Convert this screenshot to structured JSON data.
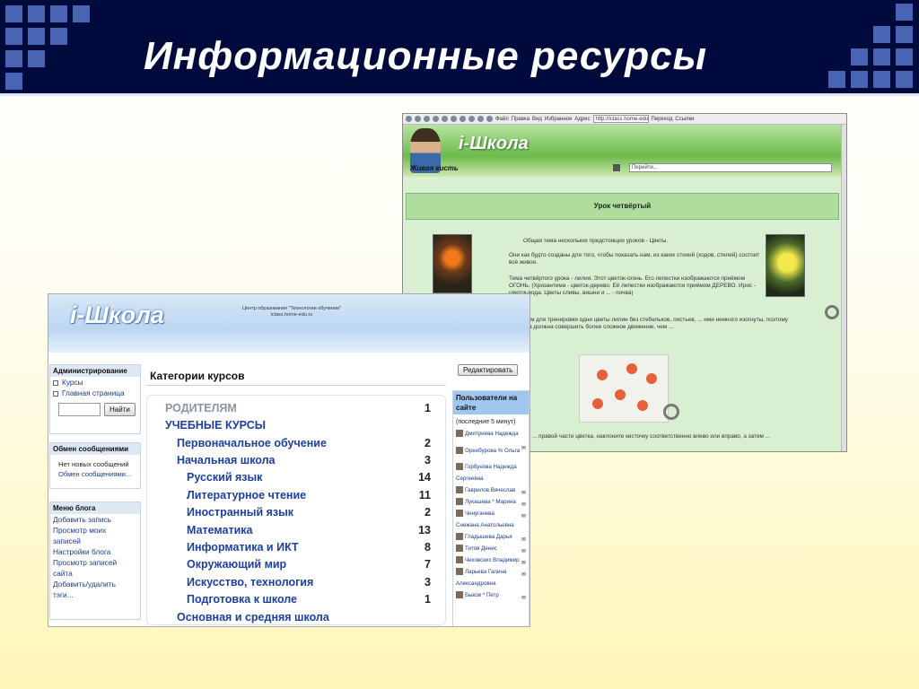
{
  "slide": {
    "title": "Информационные ресурсы",
    "accent_color": "#000a3c",
    "square_color": "#4a64b4"
  },
  "back_window": {
    "toolbar": {
      "items": [
        "Файл",
        "Правка",
        "Вид",
        "Избранное",
        "Адрес"
      ],
      "address": "http://iclass.home-edu...",
      "go_label": "Переход",
      "links_label": "Ссылки"
    },
    "logo": "i-Школа",
    "section_title": "Живая кисть",
    "goto_placeholder": "Перейти...",
    "lesson_title": "Урок четвёртый",
    "paragraphs": [
      "Общая тема нескольких предстоящих уроков - Цветы.",
      "Они как будто созданы для того, чтобы показать нам, из каких стихий (ходов, стилей) состоит всё живое.",
      "Тема четвёртого урока - лилия. Этот цветок-огонь. Его лепестки изображаются приёмом ОГОНЬ. (Хризантема - цветок-дерево. Её лепестки изображаются приёмом ДЕРЕВО. Ирис - цветок-вода. Цветы сливы, вишни и ... - почва)",
      "... рисуем для тренировки одни цветы лилии без стебельков, листьев, ... ими немного изогнуты, поэтому кисточка должна совершить более сложное движение, чем ...",
      "... правой части цветка, наклоните кисточку соответственно влево или вправо, а затем ..."
    ]
  },
  "front_window": {
    "logo": "i-Школа",
    "center_name": "Центр образования \"Технологии обучения\"",
    "center_url": "iclass.home-edu.ru",
    "admin": {
      "title": "Администрирование",
      "items": [
        "Курсы",
        "Главная страница"
      ],
      "search_button": "Найти"
    },
    "messages": {
      "title": "Обмен сообщениями",
      "none": "Нет новых сообщений",
      "link": "Обмен сообщениями..."
    },
    "blog": {
      "title": "Меню блога",
      "items": [
        "Добавить запись",
        "Просмотр моих",
        "записей",
        "Настройки блога",
        "Просмотр записей",
        "сайта",
        "Добавить/удалить",
        "тэги..."
      ]
    },
    "categories_title": "Категории курсов",
    "categories": [
      {
        "label": "РОДИТЕЛЯМ",
        "count": "1"
      },
      {
        "label": "УЧЕБНЫЕ КУРСЫ",
        "count": ""
      },
      {
        "label": "Первоначальное обучение",
        "count": "2"
      },
      {
        "label": "Начальная школа",
        "count": "3"
      },
      {
        "label": "Русский язык",
        "count": "14"
      },
      {
        "label": "Литературное чтение",
        "count": "11"
      },
      {
        "label": "Иностранный язык",
        "count": "2"
      },
      {
        "label": "Математика",
        "count": "13"
      },
      {
        "label": "Информатика и ИКТ",
        "count": "8"
      },
      {
        "label": "Окружающий мир",
        "count": "7"
      },
      {
        "label": "Искусство, технология",
        "count": "3"
      },
      {
        "label": "Подготовка к школе",
        "count": "1"
      },
      {
        "label": "Основная и средняя школа",
        "count": ""
      }
    ],
    "edit_button": "Редактировать",
    "users": {
      "title": "Пользователи на сайте",
      "period": "(последние 5 минут)",
      "list": [
        "Дмитриева Надежда",
        "Оренбурова % Ольга",
        "Горбунова Надежда",
        "Сергеевна",
        "Гаврилов Вячеслав",
        "Лукашева * Марина",
        "Чинугачева",
        "Снежана Анатольевна",
        "Гладышева Дарья",
        "Титов Денис",
        "Чеховских Владимир",
        "Ларьева Галина",
        "Александровна",
        "Быков * Петр"
      ]
    }
  }
}
